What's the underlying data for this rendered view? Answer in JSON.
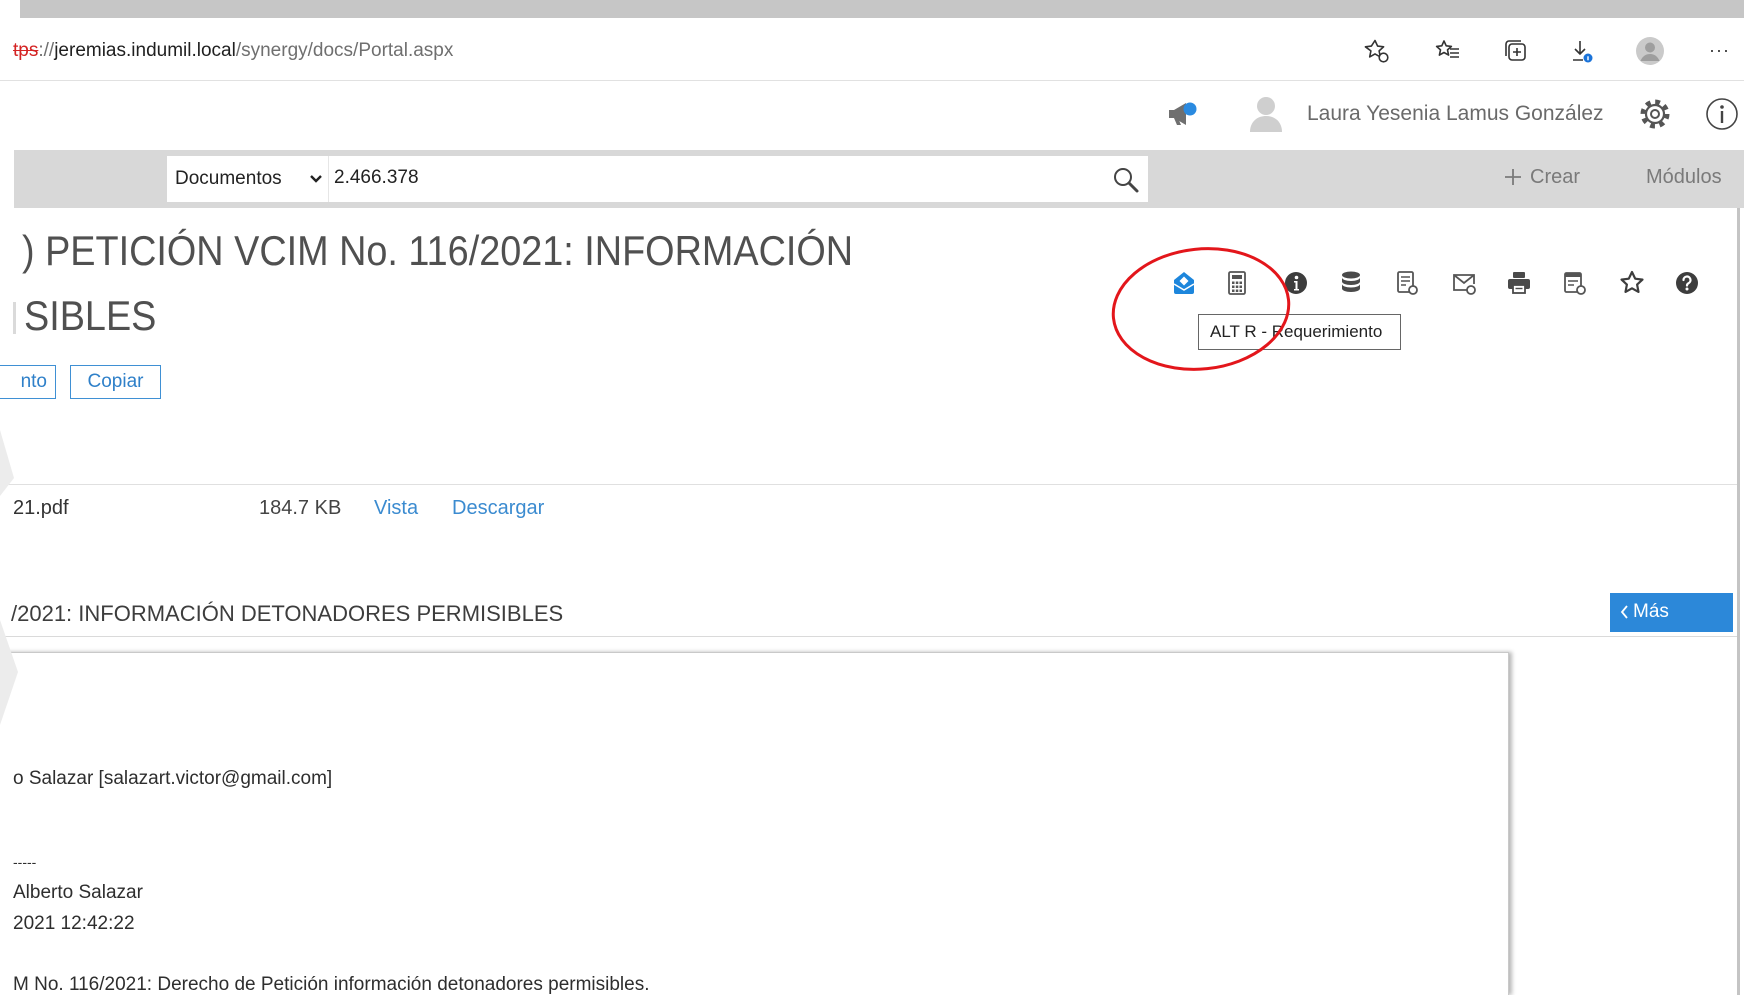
{
  "browser": {
    "url": {
      "scheme": "tps",
      "separator": "://",
      "host": "jeremias.indumil.local",
      "path": "/synergy/docs/Portal.aspx"
    },
    "toolbar_icons": [
      "add-favorite-icon",
      "favorites-icon",
      "collections-icon",
      "downloads-icon",
      "profile-icon",
      "more-icon"
    ],
    "more_label": "···"
  },
  "header": {
    "user_name": "Laura Yesenia Lamus González",
    "icons": [
      "announcements-icon",
      "user-avatar-icon",
      "settings-icon",
      "info-icon"
    ]
  },
  "search": {
    "category": "Documentos",
    "query": "2.466.378",
    "create_label": "Crear",
    "modules_label": "Módulos"
  },
  "document": {
    "title_line1": ") PETICIÓN VCIM No. 116/2021: INFORMACIÓN",
    "title_line2": "SIBLES",
    "action_buttons": [
      "nto",
      "Copiar"
    ],
    "toolbar": {
      "icons": [
        "requirement-icon",
        "calculator-icon",
        "info-filled-icon",
        "database-icon",
        "document-list-icon",
        "mail-check-icon",
        "printer-icon",
        "document-settings-icon",
        "star-icon",
        "help-icon"
      ],
      "tooltip": "ALT R - Requerimiento"
    }
  },
  "attachment": {
    "file_name": "21.pdf",
    "size": "184.7 KB",
    "view_label": "Vista",
    "download_label": "Descargar"
  },
  "section": {
    "title": "/2021: INFORMACIÓN DETONADORES PERMISIBLES",
    "more_label": "Más"
  },
  "email": {
    "lines": [
      "o Salazar [salazart.victor@gmail.com]",
      "-----",
      "Alberto Salazar",
      "2021 12:42:22",
      "M No. 116/2021: Derecho de Petición información detonadores permisibles."
    ]
  },
  "colors": {
    "accent": "#2c88d9",
    "link": "#3b8bd0",
    "insecure_scheme": "#d42323",
    "highlight_circle": "#e3161b",
    "notification_dot": "#2a8ae0",
    "search_bar": "#d8d8d8"
  }
}
